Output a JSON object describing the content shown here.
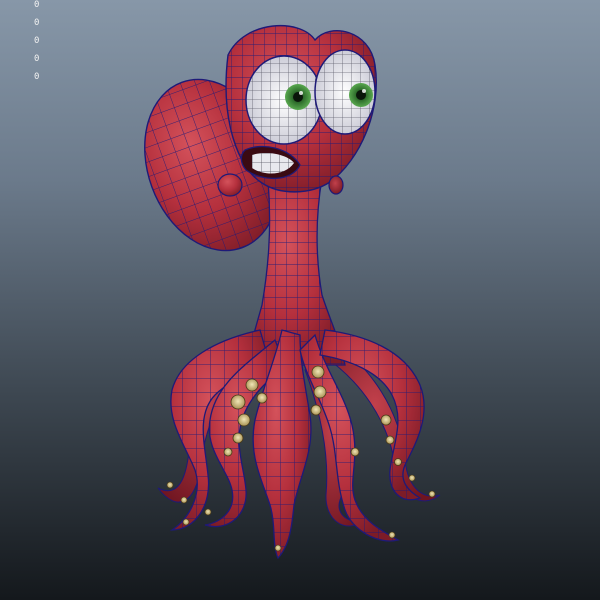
{
  "viewport": {
    "hud_values": [
      "0",
      "0",
      "0",
      "0",
      "0"
    ],
    "colors": {
      "background_top": "#8797a8",
      "background_bottom": "#14181c",
      "hud_text": "#f2f2f2",
      "surface": "#b5303d",
      "wireframe": "#1e1a78",
      "eye_white": "#f4f4f8",
      "iris": "#3e8a3a"
    },
    "model": {
      "name": "octopus-character",
      "display_mode": "shaded-with-wireframe"
    }
  }
}
